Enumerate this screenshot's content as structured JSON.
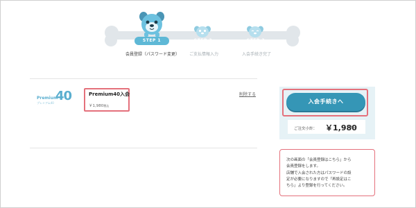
{
  "stepper": {
    "steps": [
      {
        "badge": "STEP 1",
        "label": "会員登録（パスワード変更）",
        "active": true
      },
      {
        "badge": "STEP 2",
        "label": "ご支払情報入力",
        "active": false
      },
      {
        "badge": "STEP 3",
        "label": "入会手続き完了",
        "active": false
      }
    ]
  },
  "cart": {
    "item": {
      "logo_text": "Premium",
      "logo_sub": "プレミアム40",
      "logo_number": "40",
      "name": "Premium40入会",
      "price": "￥1,980",
      "price_tax": "税込",
      "remove_label": "削除する"
    }
  },
  "checkout": {
    "cta_label": "入会手続きへ",
    "subtotal_label": "ご注文小計：",
    "subtotal_value": "￥1,980",
    "subtotal_tax": "税込"
  },
  "note": {
    "lines": [
      "次の画面の「会員登録はこちら」から",
      "会員登録をします。",
      "店舗で入会された方はパスワードの設",
      "定が必要になりますので「再設定はこ",
      "ちら」より登録を行ってください。"
    ]
  },
  "colors": {
    "accent": "#3596b6",
    "highlight": "#e4707b",
    "panel_bg": "#e6f2f6",
    "step_active": "#5eb8d6",
    "track": "#e1e6ea"
  },
  "icons": {
    "step1": "pug-mascot-icon",
    "step2": "pug-mascot-icon",
    "step3": "pug-mascot-icon"
  }
}
